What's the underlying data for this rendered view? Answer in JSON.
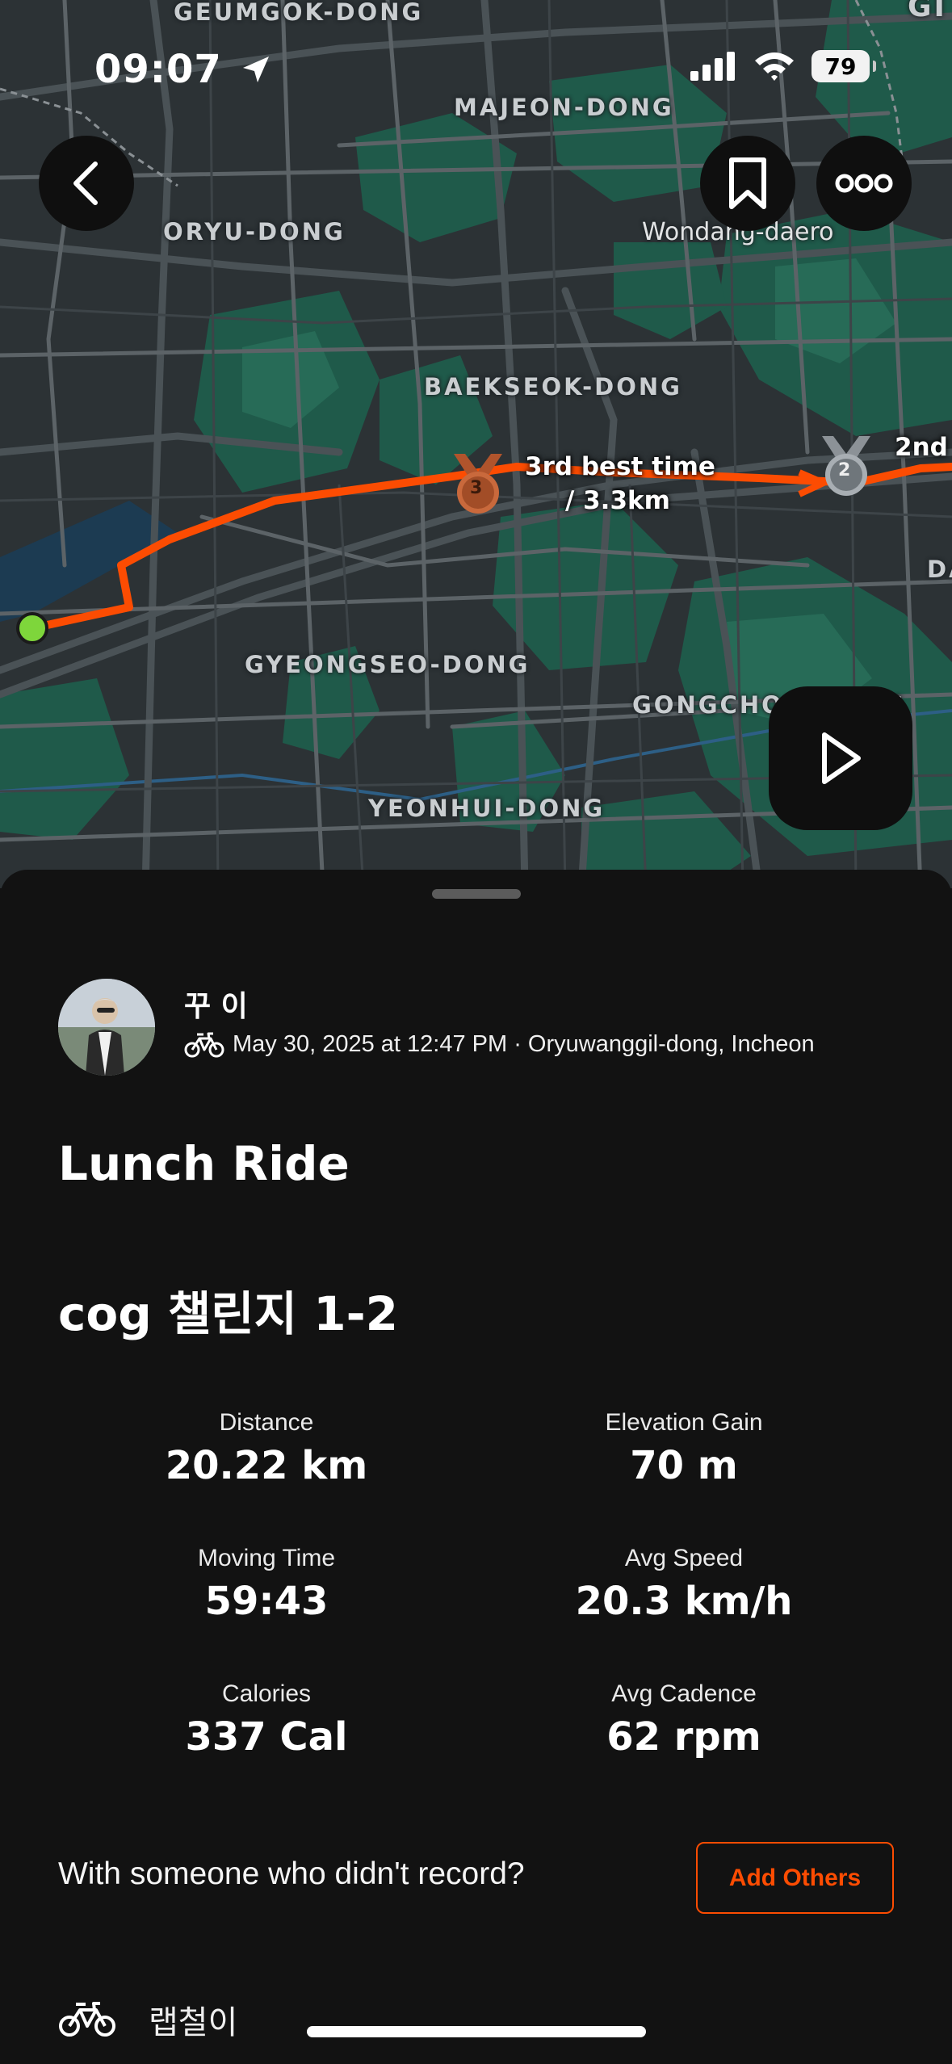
{
  "status_bar": {
    "time": "09:07",
    "battery": "79"
  },
  "map": {
    "labels": {
      "geumgok": "GEUMGOK-DONG",
      "majeon": "MAJEON-DONG",
      "oryu": "ORYU-DONG",
      "wondang": "Wondang-daero",
      "baekseok": "BAEKSEOK-DONG",
      "gyeongseo": "GYEONGSEO-DONG",
      "gongchon": "GONGCHON-DONG",
      "yeonhui": "YEONHUI-DONG",
      "gi_partial": "GI",
      "da_partial": "DA"
    },
    "segment_third": {
      "badge": "3",
      "label_line1": "3rd best time",
      "label_line2": "/   3.3km"
    },
    "segment_second": {
      "badge": "2",
      "label": "2nd"
    },
    "route_color": "#fc4c02",
    "start_color": "#7ed63b"
  },
  "activity": {
    "athlete_name": "꾸 이",
    "meta": "May 30, 2025 at 12:47 PM · Oryuwanggil-dong, Incheon",
    "title": "Lunch Ride",
    "subtitle": "cog 챌린지 1-2",
    "stats": [
      {
        "label": "Distance",
        "value": "20.22 km"
      },
      {
        "label": "Elevation Gain",
        "value": "70 m"
      },
      {
        "label": "Moving Time",
        "value": "59:43"
      },
      {
        "label": "Avg Speed",
        "value": "20.3 km/h"
      },
      {
        "label": "Calories",
        "value": "337 Cal"
      },
      {
        "label": "Avg Cadence",
        "value": "62 rpm"
      }
    ],
    "with_prompt": "With someone who didn't record?",
    "add_others_label": "Add Others",
    "gear_name": "랩철이",
    "accent_color": "#fc4c02"
  }
}
